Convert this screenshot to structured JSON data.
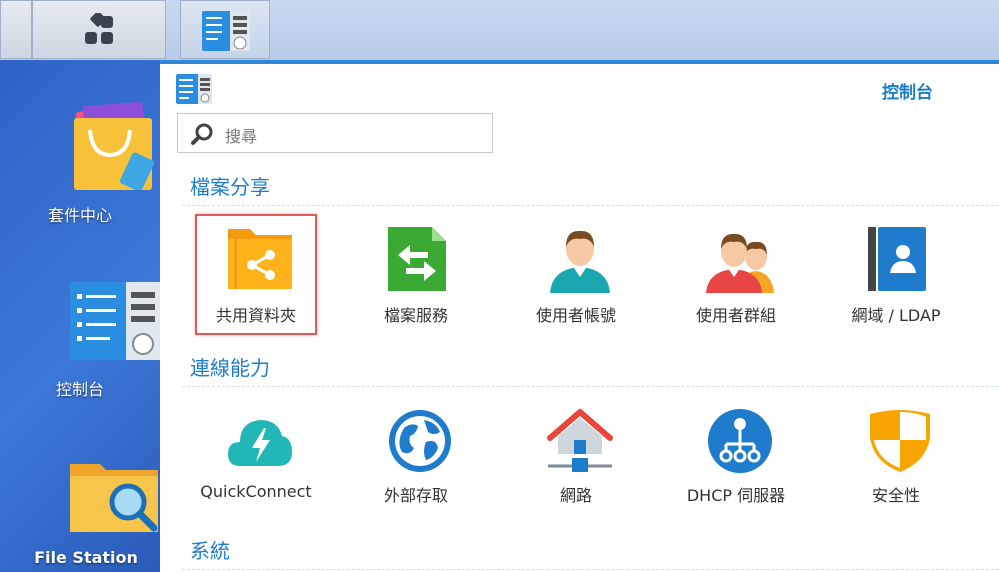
{
  "taskbar": {
    "main_icon": "grid-icon",
    "app_icon": "control-panel-icon"
  },
  "desktop": {
    "items": [
      {
        "label": "套件中心",
        "icon": "package-center-icon"
      },
      {
        "label": "控制台",
        "icon": "control-panel-icon"
      },
      {
        "label": "File Station",
        "icon": "file-station-icon"
      }
    ]
  },
  "window": {
    "title": "控制台",
    "search_placeholder": "搜尋",
    "sections": [
      {
        "title": "檔案分享",
        "items": [
          {
            "label": "共用資料夾",
            "icon": "shared-folder-icon",
            "highlighted": true
          },
          {
            "label": "檔案服務",
            "icon": "file-services-icon"
          },
          {
            "label": "使用者帳號",
            "icon": "user-icon"
          },
          {
            "label": "使用者群組",
            "icon": "group-icon"
          },
          {
            "label": "網域 / LDAP",
            "icon": "domain-ldap-icon"
          }
        ]
      },
      {
        "title": "連線能力",
        "items": [
          {
            "label": "QuickConnect",
            "icon": "quickconnect-icon"
          },
          {
            "label": "外部存取",
            "icon": "external-access-icon"
          },
          {
            "label": "網路",
            "icon": "network-icon"
          },
          {
            "label": "DHCP 伺服器",
            "icon": "dhcp-server-icon"
          },
          {
            "label": "安全性",
            "icon": "security-icon"
          }
        ]
      },
      {
        "title": "系統",
        "items": []
      }
    ]
  },
  "colors": {
    "accent": "#1f7ccd",
    "highlight_border": "#e05a5a"
  }
}
